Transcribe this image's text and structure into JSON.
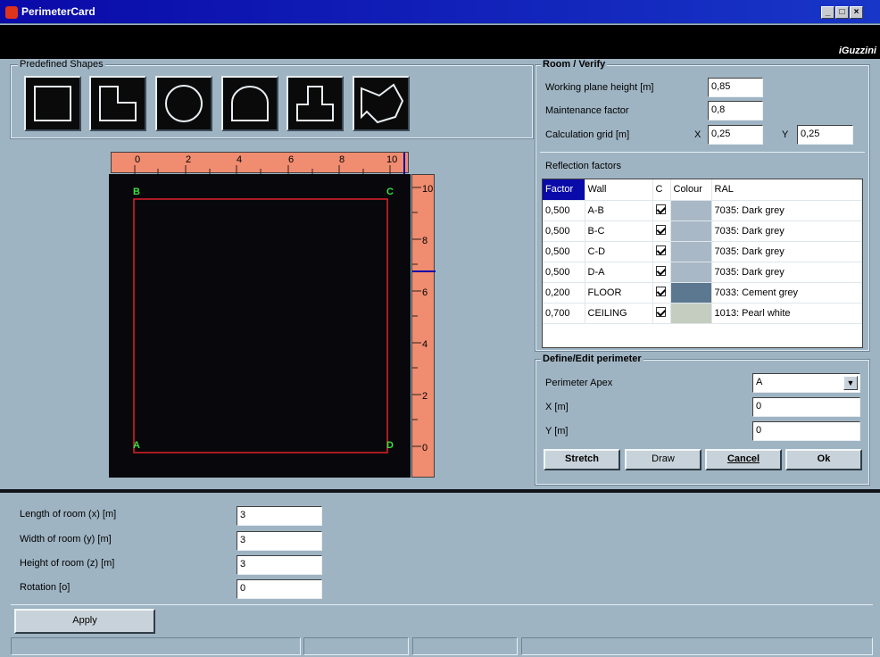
{
  "window": {
    "title": "PerimeterCard",
    "brand": "iGuzzini",
    "minimize": "_",
    "maximize": "□",
    "close": "×"
  },
  "shapes": {
    "label": "Predefined Shapes",
    "items": [
      "square-shape-icon",
      "l-shape-icon",
      "circle-shape-icon",
      "arch-shape-icon",
      "t-shape-icon",
      "irregular-shape-icon"
    ]
  },
  "rulers": {
    "horizontal": [
      "0",
      "2",
      "4",
      "6",
      "8",
      "10"
    ],
    "vertical": [
      "10",
      "8",
      "6",
      "4",
      "2",
      "0"
    ]
  },
  "canvas": {
    "corner_a": "A",
    "corner_b": "B",
    "corner_c": "C",
    "corner_d": "D",
    "perimeter_color": "#e0202a",
    "corner_color": "#3ce03c"
  },
  "room": {
    "label": "Room / Verify",
    "working_plane_label": "Working plane height [m]",
    "working_plane_value": "0,85",
    "maintenance_label": "Maintenance factor",
    "maintenance_value": "0,8",
    "grid_label": "Calculation grid [m]",
    "x_label": "X",
    "x_value": "0,25",
    "y_label": "Y",
    "y_value": "0,25"
  },
  "reflection": {
    "label": "Reflection factors",
    "columns": [
      "Factor",
      "Wall",
      "C",
      "Colour",
      "RAL"
    ],
    "rows": [
      {
        "factor": "0,500",
        "wall": "A-B",
        "ral": "7035: Dark grey",
        "colour": "#a8b8c6"
      },
      {
        "factor": "0,500",
        "wall": "B-C",
        "ral": "7035: Dark grey",
        "colour": "#a8b8c6"
      },
      {
        "factor": "0,500",
        "wall": "C-D",
        "ral": "7035: Dark grey",
        "colour": "#a8b8c6"
      },
      {
        "factor": "0,500",
        "wall": "D-A",
        "ral": "7035: Dark grey",
        "colour": "#a8b8c6"
      },
      {
        "factor": "0,200",
        "wall": "FLOOR",
        "ral": "7033: Cement grey",
        "colour": "#5c7890"
      },
      {
        "factor": "0,700",
        "wall": "CEILING",
        "ral": "1013: Pearl white",
        "colour": "#c4cdc0"
      }
    ]
  },
  "perimeter": {
    "label": "Define/Edit perimeter",
    "apex_label": "Perimeter Apex",
    "apex_value": "A",
    "x_label": "X [m]",
    "x_value": "0",
    "y_label": "Y [m]",
    "y_value": "0",
    "stretch": "Stretch",
    "draw": "Draw",
    "cancel": "Cancel",
    "ok": "Ok"
  },
  "dimensions": {
    "length_label": "Length of room (x) [m]",
    "length_value": "3",
    "width_label": "Width of room (y) [m]",
    "width_value": "3",
    "height_label": "Height of room (z) [m]",
    "height_value": "3",
    "rotation_label": "Rotation [o]",
    "rotation_value": "0"
  },
  "apply": "Apply"
}
